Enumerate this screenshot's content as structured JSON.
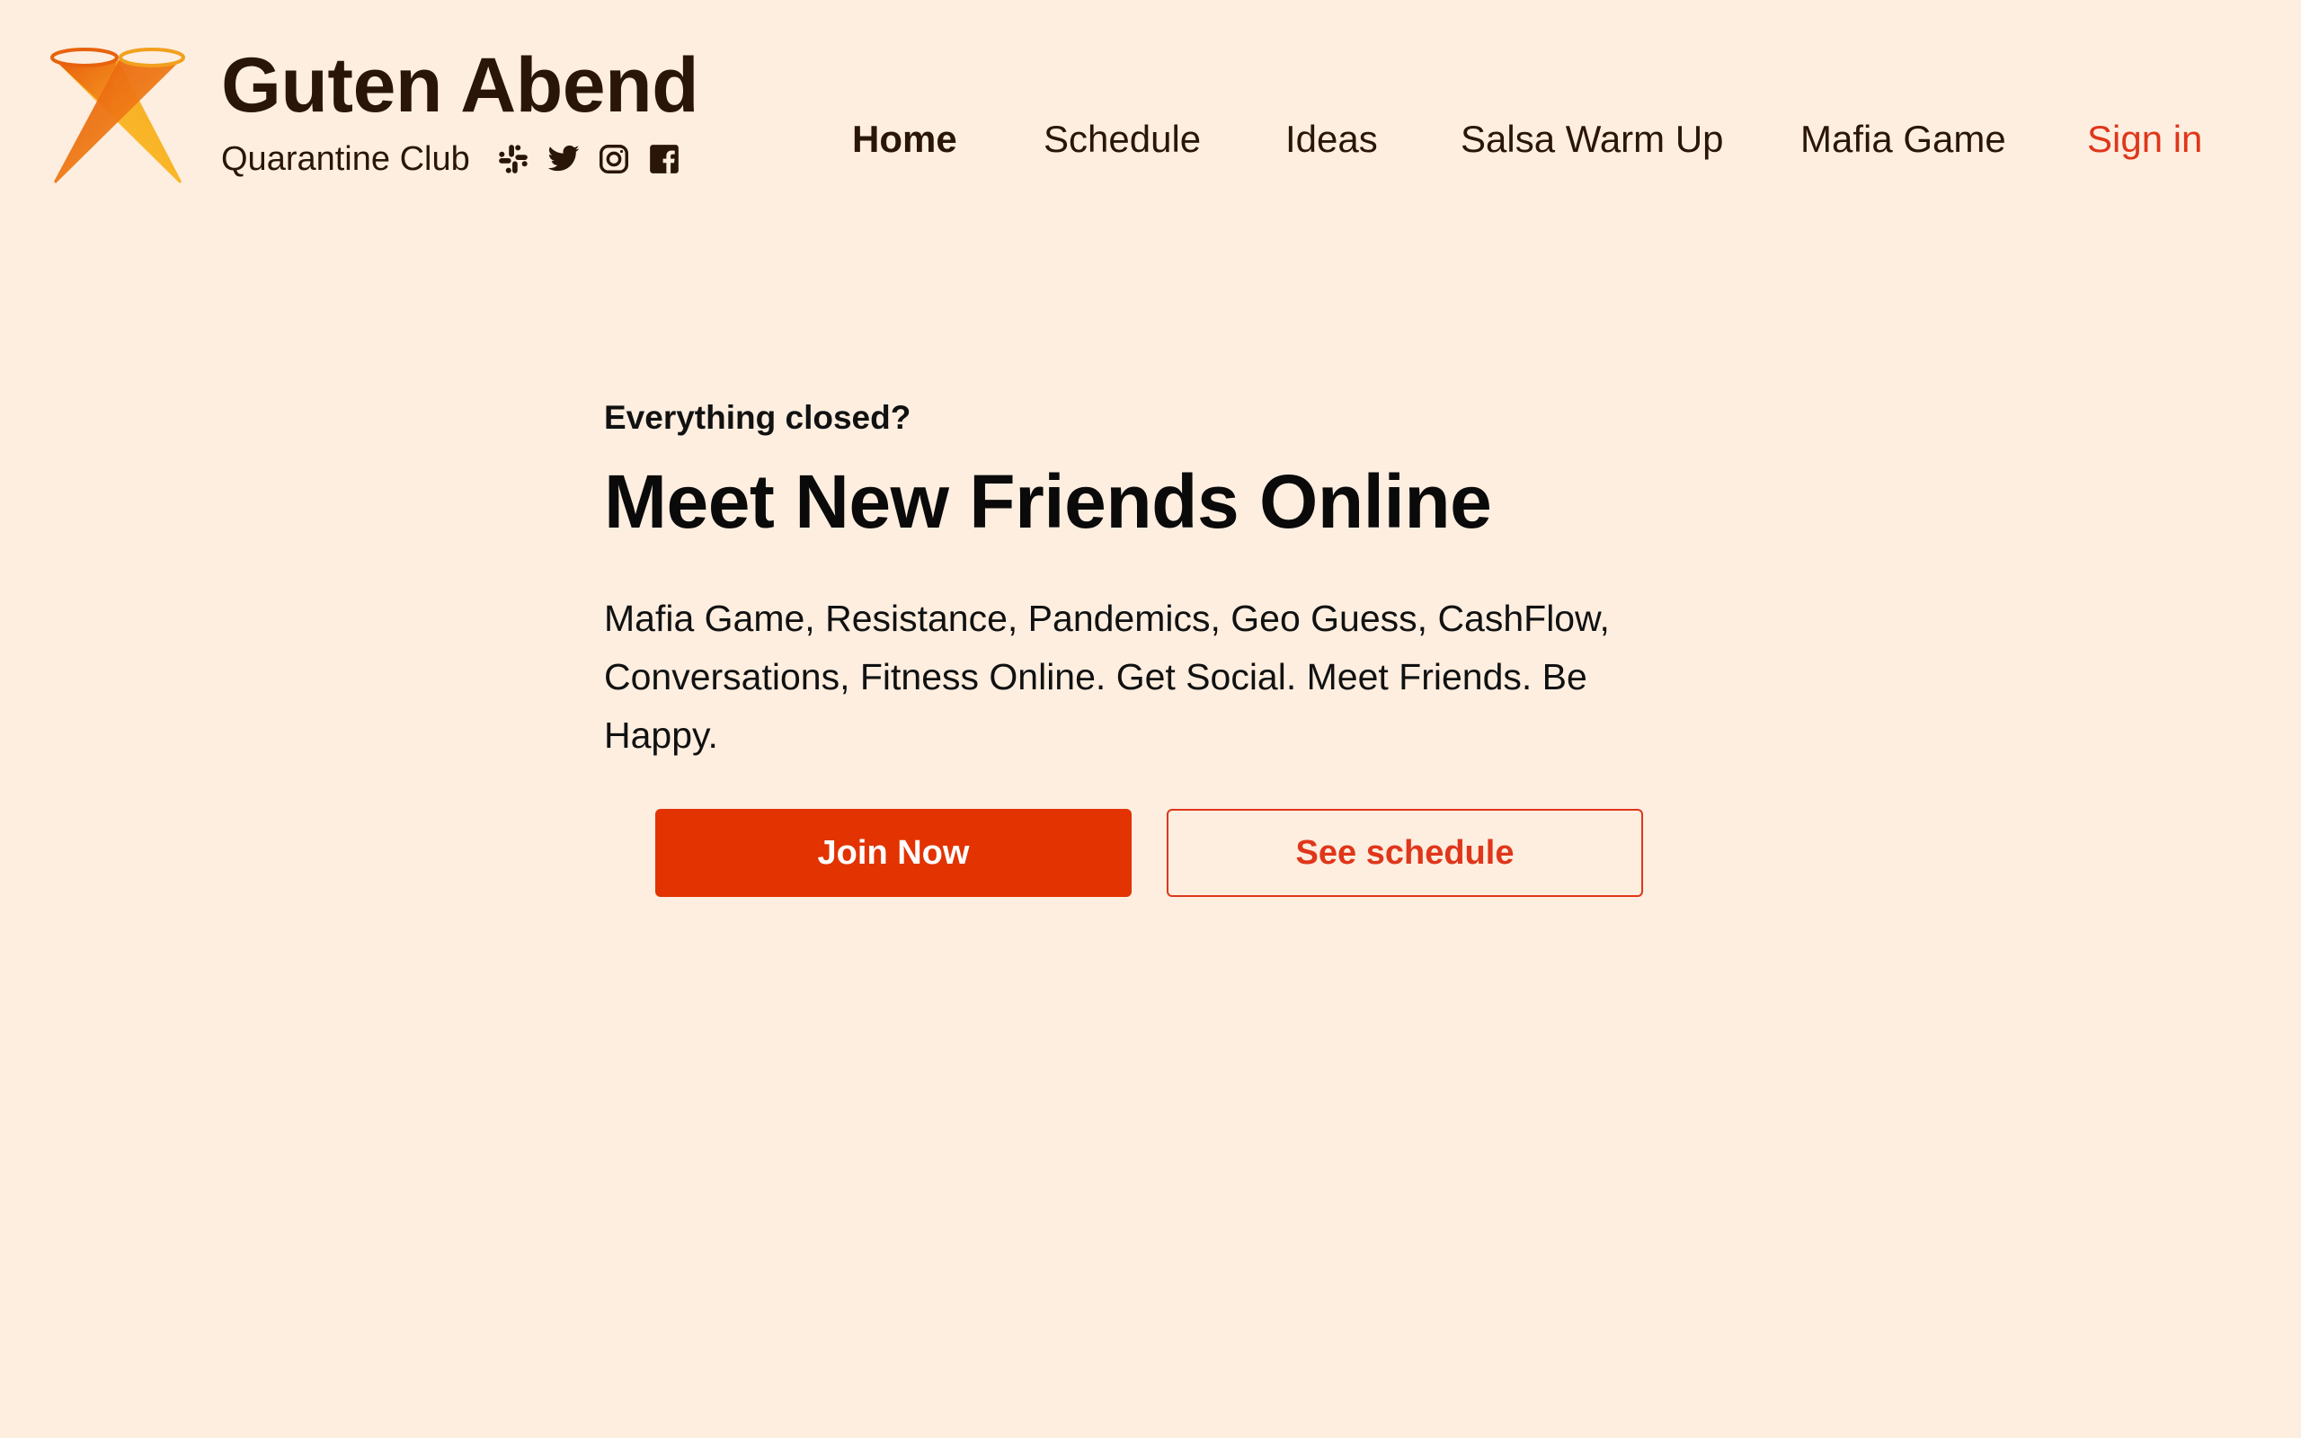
{
  "colors": {
    "background": "#FDEEE0",
    "brand_text": "#2A1608",
    "accent": "#E0361A",
    "primary_button": "#E23300",
    "logo_orange": "#F07A10",
    "logo_yellow": "#FBBF2A"
  },
  "brand": {
    "title": "Guten Abend",
    "subtitle": "Quarantine Club",
    "logo_icon": "crossed-cones-logo",
    "socials": [
      {
        "name": "slack",
        "icon": "slack-icon"
      },
      {
        "name": "twitter",
        "icon": "twitter-icon"
      },
      {
        "name": "instagram",
        "icon": "instagram-icon"
      },
      {
        "name": "facebook",
        "icon": "facebook-icon"
      }
    ]
  },
  "nav": {
    "items": [
      {
        "label": "Home",
        "active": true
      },
      {
        "label": "Schedule"
      },
      {
        "label": "Ideas"
      },
      {
        "label": "Salsa Warm Up"
      },
      {
        "label": "Mafia Game"
      }
    ],
    "sign_in": "Sign in"
  },
  "hero": {
    "eyebrow": "Everything closed?",
    "headline": "Meet New Friends Online",
    "description": "Mafia Game, Resistance, Pandemics, Geo Guess, CashFlow, Conversations, Fitness Online. Get Social. Meet Friends. Be Happy.",
    "primary_button": "Join Now",
    "secondary_button": "See schedule"
  }
}
